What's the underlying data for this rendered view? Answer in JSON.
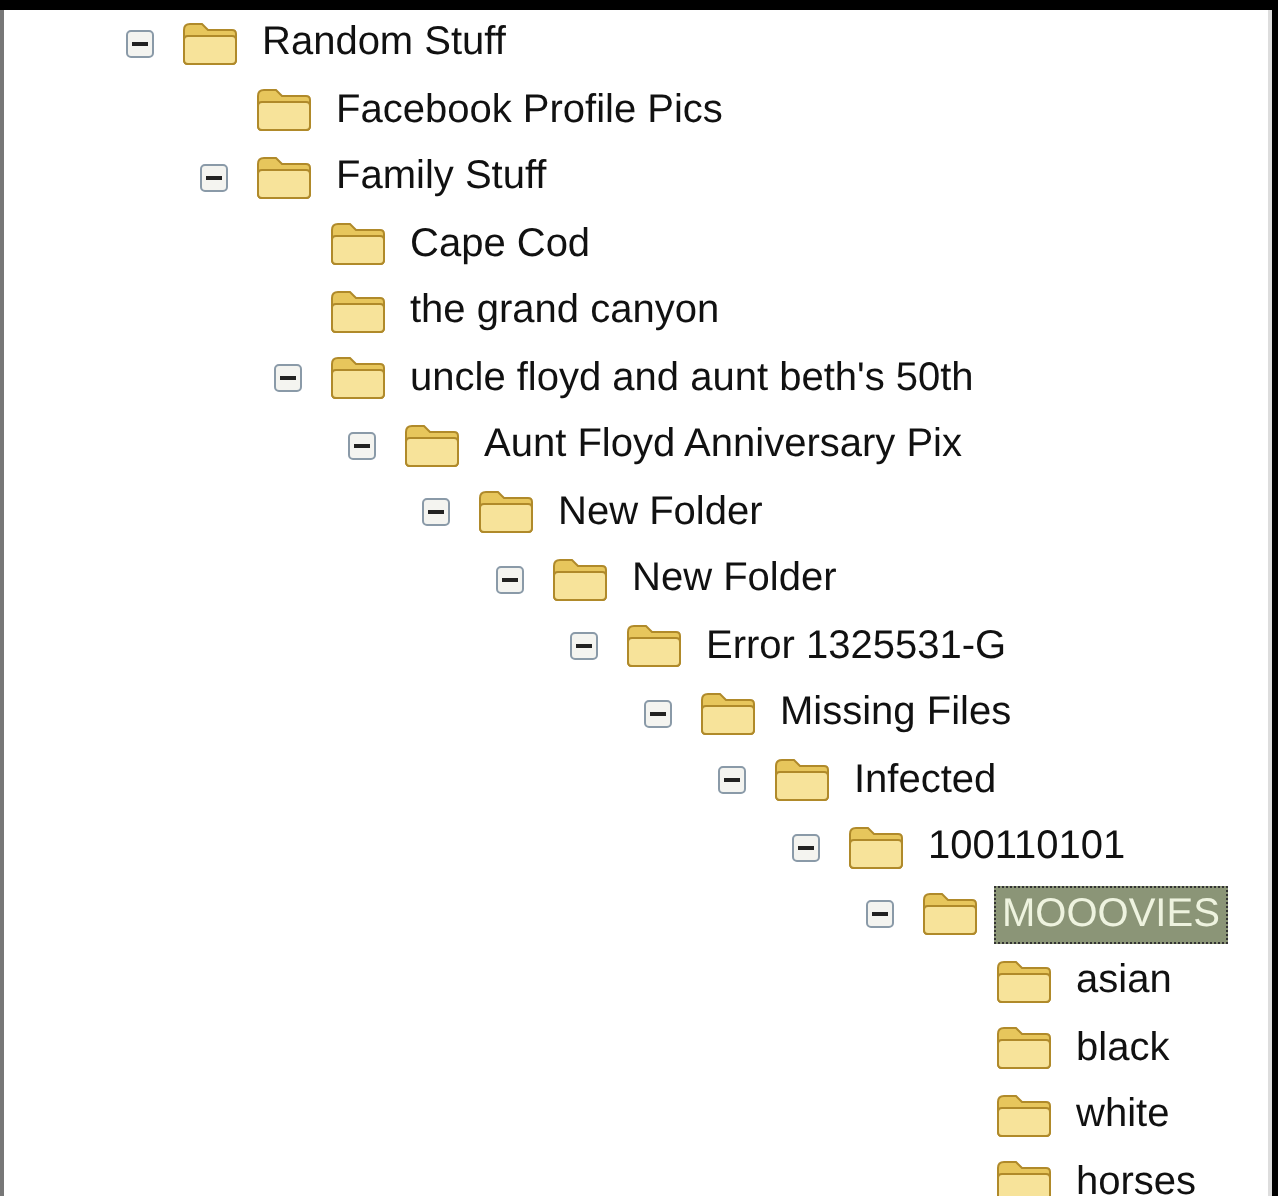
{
  "tree": [
    {
      "label": "Random Stuff",
      "expanded": true,
      "selected": false,
      "children": [
        {
          "label": "Facebook Profile Pics",
          "selected": false
        },
        {
          "label": "Family Stuff",
          "expanded": true,
          "selected": false,
          "children": [
            {
              "label": "Cape Cod",
              "selected": false
            },
            {
              "label": "the grand canyon",
              "selected": false
            },
            {
              "label": "uncle floyd and aunt beth's 50th",
              "expanded": true,
              "selected": false,
              "children": [
                {
                  "label": "Aunt Floyd Anniversary Pix",
                  "expanded": true,
                  "selected": false,
                  "children": [
                    {
                      "label": "New Folder",
                      "expanded": true,
                      "selected": false,
                      "children": [
                        {
                          "label": "New Folder",
                          "expanded": true,
                          "selected": false,
                          "children": [
                            {
                              "label": "Error 1325531-G",
                              "expanded": true,
                              "selected": false,
                              "children": [
                                {
                                  "label": "Missing Files",
                                  "expanded": true,
                                  "selected": false,
                                  "children": [
                                    {
                                      "label": "Infected",
                                      "expanded": true,
                                      "selected": false,
                                      "children": [
                                        {
                                          "label": "100110101",
                                          "expanded": true,
                                          "selected": false,
                                          "children": [
                                            {
                                              "label": "MOOOVIES",
                                              "expanded": true,
                                              "selected": true,
                                              "children": [
                                                {
                                                  "label": "asian",
                                                  "selected": false
                                                },
                                                {
                                                  "label": "black",
                                                  "selected": false
                                                },
                                                {
                                                  "label": "white",
                                                  "selected": false
                                                },
                                                {
                                                  "label": "horses",
                                                  "selected": false
                                                }
                                              ]
                                            }
                                          ]
                                        }
                                      ]
                                    }
                                  ]
                                }
                              ]
                            }
                          ]
                        }
                      ]
                    }
                  ]
                }
              ]
            }
          ]
        }
      ]
    }
  ]
}
